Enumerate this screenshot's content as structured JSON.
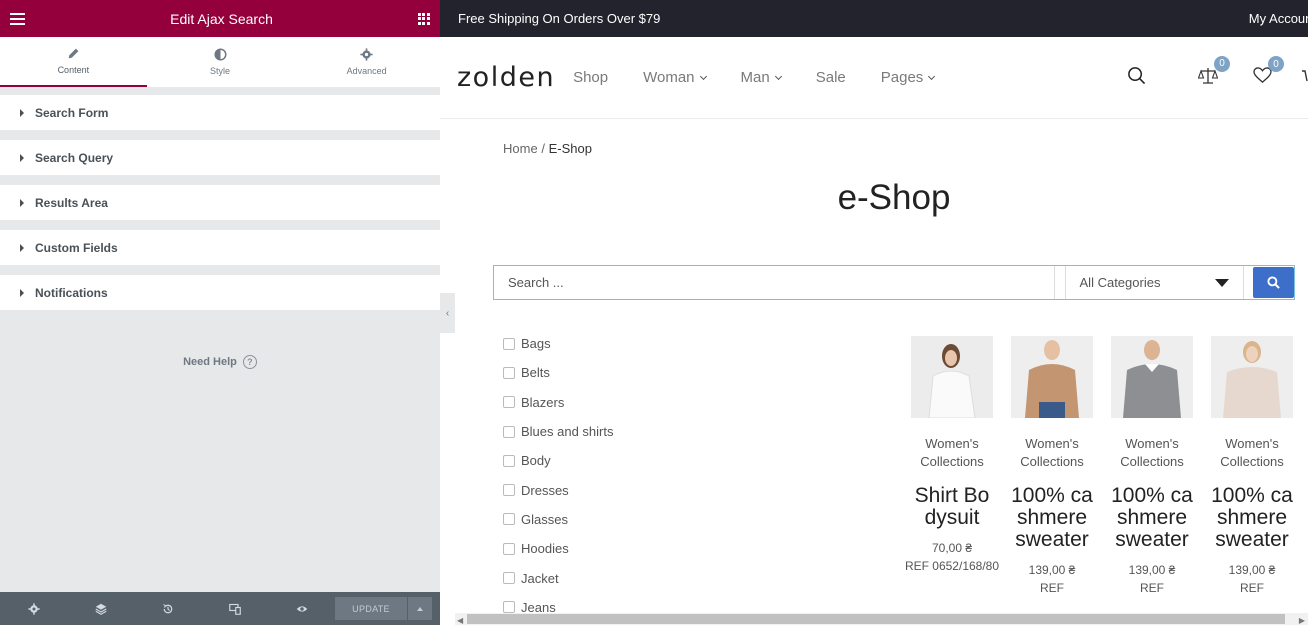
{
  "editor": {
    "title": "Edit Ajax Search",
    "tabs": [
      {
        "label": "Content",
        "icon": "pencil-icon"
      },
      {
        "label": "Style",
        "icon": "half-circle-icon"
      },
      {
        "label": "Advanced",
        "icon": "gear-icon"
      }
    ],
    "sections": [
      "Search Form",
      "Search Query",
      "Results Area",
      "Custom Fields",
      "Notifications"
    ],
    "need_help": "Need Help",
    "footer": {
      "icons": [
        "gear-icon",
        "layers-icon",
        "history-icon",
        "responsive-icon",
        "eye-icon"
      ],
      "update_label": "UPDATE"
    },
    "accent_color": "#93003c"
  },
  "preview": {
    "topbar": {
      "promo": "Free Shipping On Orders Over $79",
      "account": "My Account"
    },
    "logo": "zolden",
    "nav": [
      {
        "label": "Shop",
        "dropdown": false
      },
      {
        "label": "Woman",
        "dropdown": true
      },
      {
        "label": "Man",
        "dropdown": true
      },
      {
        "label": "Sale",
        "dropdown": false
      },
      {
        "label": "Pages",
        "dropdown": true
      }
    ],
    "icons": {
      "compare_count": "0",
      "wishlist_count": "0"
    },
    "breadcrumb": {
      "home": "Home",
      "sep": "/",
      "current": "E-Shop"
    },
    "page_title": "e-Shop",
    "search": {
      "placeholder": "Search ...",
      "category": "All Categories"
    },
    "filters": [
      "Bags",
      "Belts",
      "Blazers",
      "Blues and shirts",
      "Body",
      "Dresses",
      "Glasses",
      "Hoodies",
      "Jacket",
      "Jeans"
    ],
    "products": [
      {
        "category": "Women's Collections",
        "name": "Shirt Bodysuit",
        "price": "70,00 ₴",
        "ref": "REF 0652/168/80"
      },
      {
        "category": "Women's Collections",
        "name": "100% cashmere sweater",
        "price": "139,00 ₴",
        "ref": "REF"
      },
      {
        "category": "Women's Collections",
        "name": "100% cashmere sweater",
        "price": "139,00 ₴",
        "ref": "REF"
      },
      {
        "category": "Women's Collections",
        "name": "100% cashmere sweater",
        "price": "139,00 ₴",
        "ref": "REF"
      }
    ]
  }
}
